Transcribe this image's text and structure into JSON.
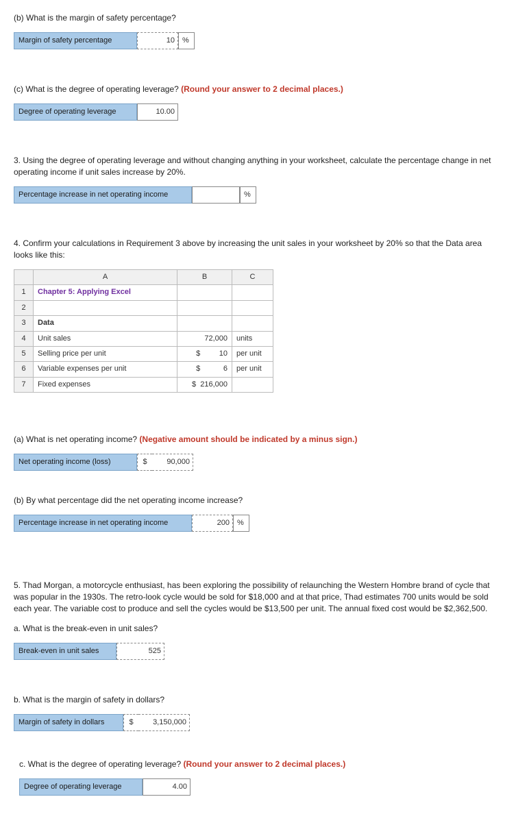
{
  "qb": {
    "prompt": "(b) What is the margin of safety percentage?",
    "label": "Margin of safety percentage",
    "value": "10",
    "unit": "%"
  },
  "qc": {
    "prompt_plain": "(c) What is the degree of operating leverage? ",
    "prompt_hint": "(Round your answer to 2 decimal places.)",
    "label": "Degree of operating leverage",
    "value": "10.00"
  },
  "q3": {
    "prompt": "3. Using the degree of operating leverage and without changing anything in your worksheet, calculate the percentage change in net operating income if unit sales increase by 20%.",
    "label": "Percentage increase in net operating income",
    "value": "",
    "unit": "%"
  },
  "q4": {
    "prompt": "4. Confirm your calculations in Requirement 3 above by increasing the unit sales in your worksheet by 20% so that the Data area looks like this:",
    "headers": {
      "a": "A",
      "b": "B",
      "c": "C"
    },
    "rows": [
      {
        "n": "1",
        "a": "Chapter 5: Applying Excel",
        "b": "",
        "c": "",
        "style": "chapter"
      },
      {
        "n": "2",
        "a": "",
        "b": "",
        "c": ""
      },
      {
        "n": "3",
        "a": "Data",
        "b": "",
        "c": "",
        "style": "bold"
      },
      {
        "n": "4",
        "a": "Unit sales",
        "b": "72,000",
        "c": "units"
      },
      {
        "n": "5",
        "a": "Selling price per unit",
        "b": "$         10",
        "c": "per unit"
      },
      {
        "n": "6",
        "a": "Variable expenses per unit",
        "b": "$           6",
        "c": "per unit"
      },
      {
        "n": "7",
        "a": "Fixed expenses",
        "b": "$  216,000",
        "c": ""
      }
    ]
  },
  "q4a": {
    "prompt_plain": "(a) What is net operating income? ",
    "prompt_hint": "(Negative amount should be indicated by a minus sign.)",
    "label": "Net operating income (loss)",
    "prefix": "$",
    "value": "90,000"
  },
  "q4b": {
    "prompt": "(b) By what percentage did the net operating income increase?",
    "label": "Percentage increase in net operating income",
    "value": "200",
    "unit": "%"
  },
  "q5": {
    "intro": "5. Thad Morgan, a motorcycle enthusiast, has been exploring the possibility of relaunching the Western Hombre brand of cycle that was popular in the 1930s. The retro-look cycle would be sold for $18,000 and at that price, Thad estimates 700 units would be sold each year. The variable cost to produce and sell the cycles would be $13,500 per unit. The annual fixed cost would be $2,362,500.",
    "a": {
      "prompt": "a. What is the break-even in unit sales?",
      "label": "Break-even in unit sales",
      "value": "525"
    },
    "b": {
      "prompt": "b. What is the margin of safety in dollars?",
      "label": "Margin of safety in dollars",
      "prefix": "$",
      "value": "3,150,000"
    },
    "c": {
      "prompt_plain": "c. What is the degree of operating leverage? ",
      "prompt_hint": "(Round your answer to 2 decimal places.)",
      "label": "Degree of operating leverage",
      "value": "4.00"
    }
  }
}
